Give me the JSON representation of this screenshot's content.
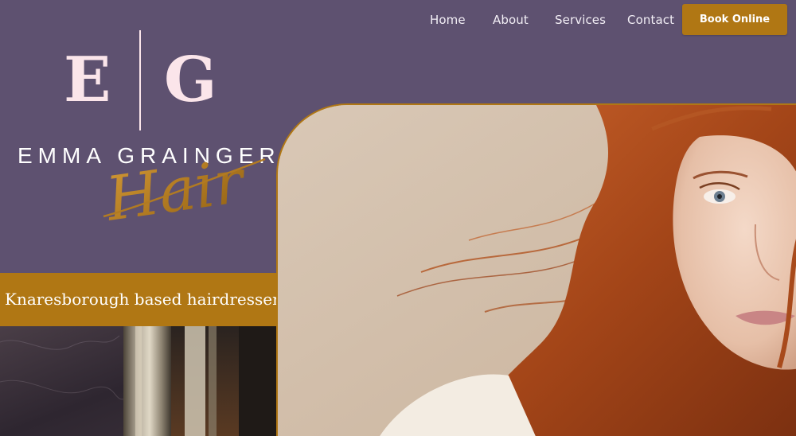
{
  "nav": {
    "home": "Home",
    "about": "About",
    "services": "Services",
    "contact": "Contact",
    "book_online": "Book Online"
  },
  "logo": {
    "monogram_left": "E",
    "monogram_right": "G",
    "name": "EMMA GRAINGER",
    "script": "Hair"
  },
  "tagline": "Knaresborough based hairdresser",
  "colors": {
    "background": "#5e5170",
    "accent": "#b07714",
    "monogram": "#fbe5ea"
  }
}
